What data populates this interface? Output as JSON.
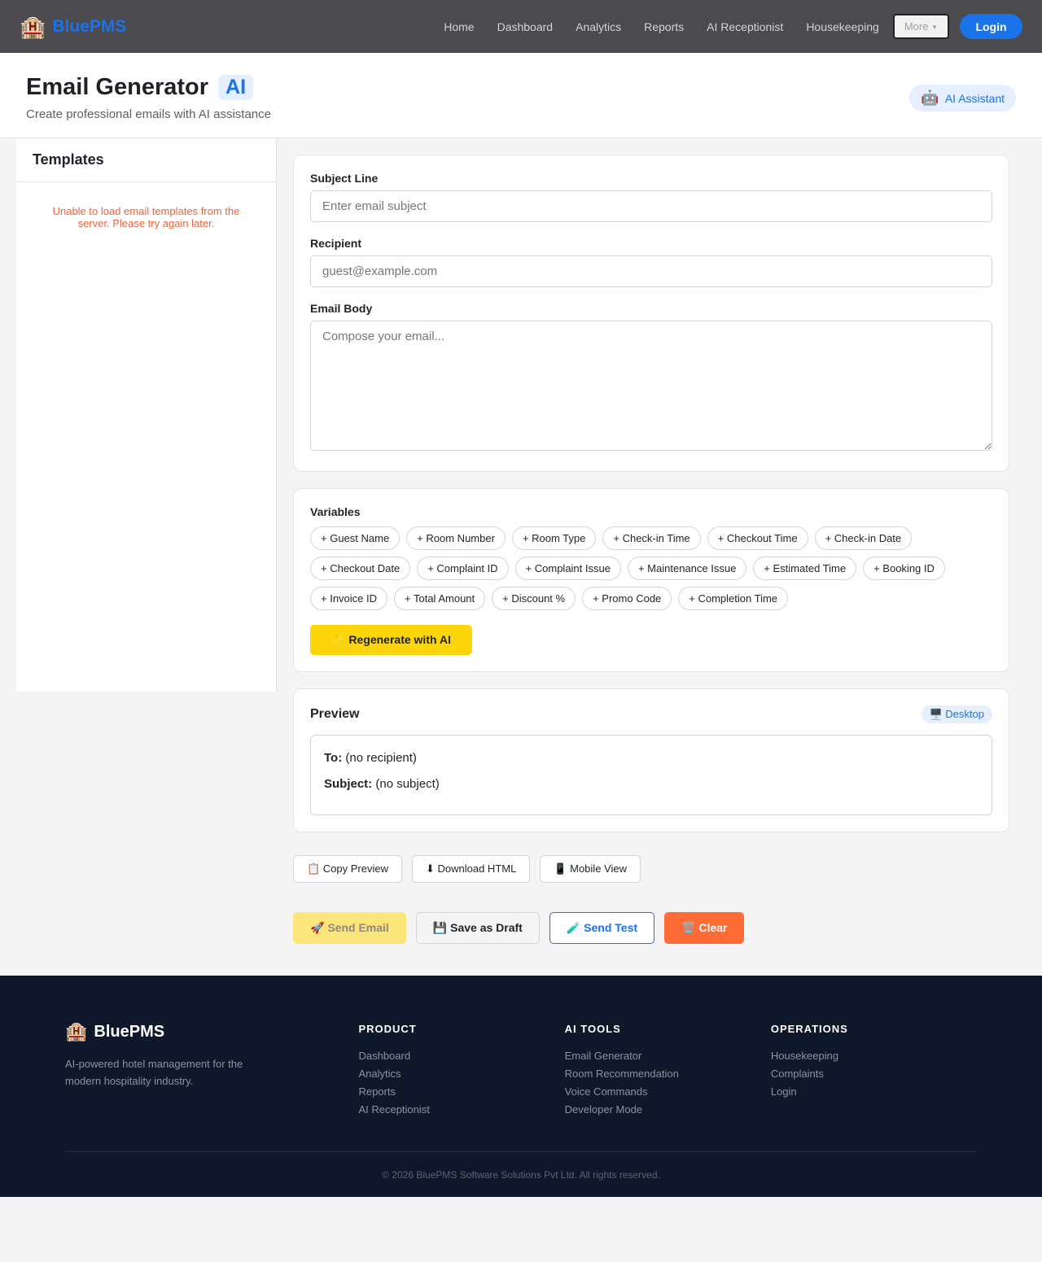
{
  "nav": {
    "brand_icon": "🏨",
    "brand": "BluePMS",
    "links": [
      "Home",
      "Dashboard",
      "Analytics",
      "Reports",
      "AI Receptionist",
      "Housekeeping"
    ],
    "more_label": "More",
    "login_label": "Login"
  },
  "header": {
    "title": "Email Generator",
    "badge": "AI",
    "subtitle": "Create professional emails with AI assistance",
    "assistant_icon": "🤖",
    "assistant_label": "AI Assistant"
  },
  "sidebar": {
    "title": "Templates",
    "error": "Unable to load email templates from the server. Please try again later."
  },
  "form": {
    "subject_label": "Subject Line",
    "subject_placeholder": "Enter email subject",
    "recipient_label": "Recipient",
    "recipient_placeholder": "guest@example.com",
    "body_label": "Email Body",
    "body_placeholder": "Compose your email..."
  },
  "variables": {
    "title": "Variables",
    "chips": [
      "+ Guest Name",
      "+ Room Number",
      "+ Room Type",
      "+ Check-in Time",
      "+ Checkout Time",
      "+ Check-in Date",
      "+ Checkout Date",
      "+ Complaint ID",
      "+ Complaint Issue",
      "+ Maintenance Issue",
      "+ Estimated Time",
      "+ Booking ID",
      "+ Invoice ID",
      "+ Total Amount",
      "+ Discount %",
      "+ Promo Code",
      "+ Completion Time"
    ],
    "regen_label": "✨ Regenerate with AI"
  },
  "preview": {
    "title": "Preview",
    "mode": "🖥️ Desktop",
    "to_label": "To:",
    "to_value": "(no recipient)",
    "subject_label": "Subject:",
    "subject_value": "(no subject)"
  },
  "tools": {
    "copy": "📋 Copy Preview",
    "download": "⬇ Download HTML",
    "mobile": "📱 Mobile View"
  },
  "actions": {
    "send": "🚀 Send Email",
    "draft": "💾 Save as Draft",
    "test": "🧪 Send Test",
    "clear": "🗑️ Clear"
  },
  "footer": {
    "brand_icon": "🏨",
    "brand": "BluePMS",
    "description": "AI-powered hotel management for the modern hospitality industry.",
    "columns": [
      {
        "title": "PRODUCT",
        "links": [
          "Dashboard",
          "Analytics",
          "Reports",
          "AI Receptionist"
        ]
      },
      {
        "title": "AI TOOLS",
        "links": [
          "Email Generator",
          "Room Recommendation",
          "Voice Commands",
          "Developer Mode"
        ]
      },
      {
        "title": "OPERATIONS",
        "links": [
          "Housekeeping",
          "Complaints",
          "Login"
        ]
      }
    ],
    "copyright": "© 2026 BluePMS Software Solutions Pvt Ltd. All rights reserved."
  },
  "colors": {
    "accent": "#1a73e8",
    "nav_bg": "#4a4a4f",
    "yellow": "#fcd60a",
    "orange": "#ff6b35",
    "footer_bg": "#0f172a"
  }
}
